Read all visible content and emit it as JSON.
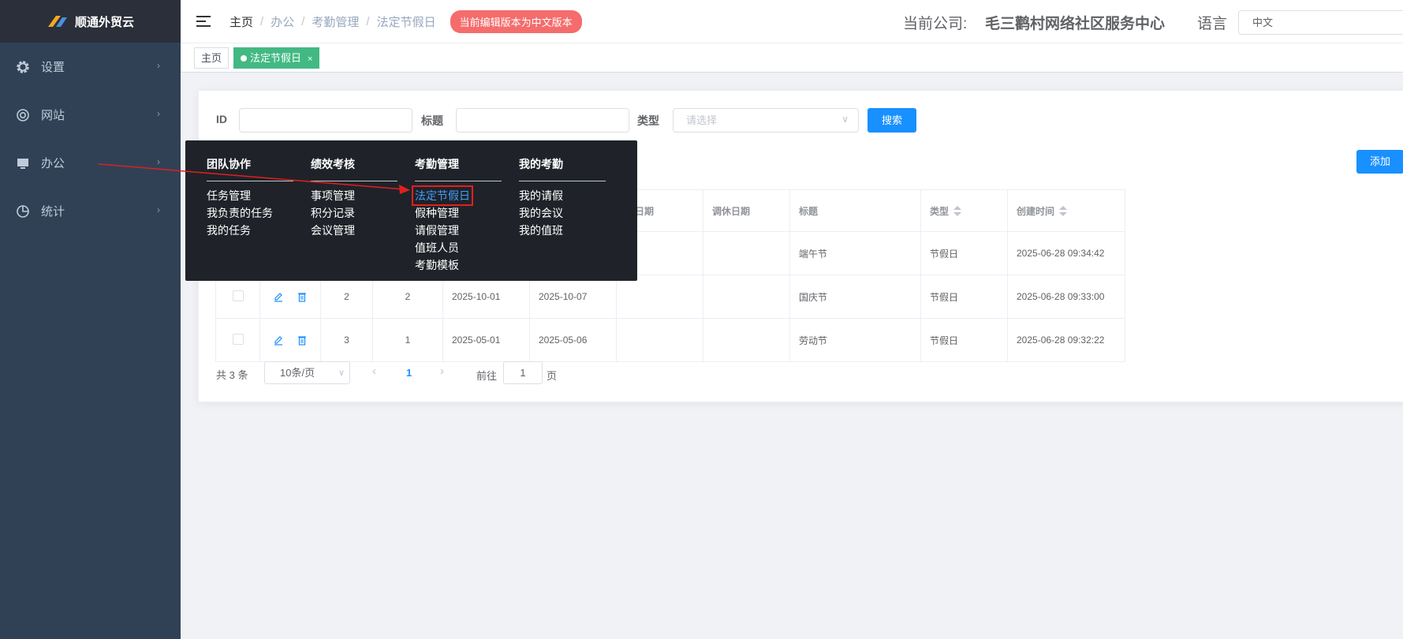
{
  "app": {
    "name": "顺通外贸云"
  },
  "sidebar": {
    "items": [
      {
        "label": "设置",
        "icon": "gear-icon"
      },
      {
        "label": "网站",
        "icon": "lifebuoy-icon"
      },
      {
        "label": "办公",
        "icon": "monitor-icon"
      },
      {
        "label": "统计",
        "icon": "pie-chart-icon"
      }
    ]
  },
  "header": {
    "breadcrumb": [
      "主页",
      "办公",
      "考勤管理",
      "法定节假日"
    ],
    "lang_badge": "当前编辑版本为中文版本",
    "company_label": "当前公司:",
    "company_name": "毛三鹳村网络社区服务中心",
    "lang_label": "语言",
    "lang_value": "中文"
  },
  "tags": {
    "home": "主页",
    "active": "法定节假日",
    "close": "×"
  },
  "filters": {
    "id_label": "ID",
    "title_label": "标题",
    "type_label": "类型",
    "type_placeholder": "请选择",
    "search_button": "搜索",
    "add_button": "添加"
  },
  "table": {
    "headers": [
      "",
      "",
      "",
      "",
      "",
      "",
      "班日期",
      "调休日期",
      "标题",
      "类型",
      "创建时间"
    ],
    "rows": [
      {
        "id": "",
        "num": "",
        "start": "",
        "end": "",
        "work": "",
        "rest": "",
        "title": "端午节",
        "type": "节假日",
        "created": "2025-06-28 09:34:42"
      },
      {
        "id": "2",
        "num": "2",
        "start": "2025-10-01",
        "end": "2025-10-07",
        "work": "",
        "rest": "",
        "title": "国庆节",
        "type": "节假日",
        "created": "2025-06-28 09:33:00"
      },
      {
        "id": "3",
        "num": "1",
        "start": "2025-05-01",
        "end": "2025-05-06",
        "work": "",
        "rest": "",
        "title": "劳动节",
        "type": "节假日",
        "created": "2025-06-28 09:32:22"
      }
    ]
  },
  "pagination": {
    "total": "共 3 条",
    "page_size": "10条/页",
    "current": "1",
    "goto_label": "前往",
    "goto_value": "1",
    "page_suffix": "页"
  },
  "mega_menu": {
    "columns": [
      {
        "title": "团队协作",
        "items": [
          "任务管理",
          "我负责的任务",
          "我的任务"
        ]
      },
      {
        "title": "绩效考核",
        "items": [
          "事项管理",
          "积分记录",
          "会议管理"
        ]
      },
      {
        "title": "考勤管理",
        "items": [
          "法定节假日",
          "假种管理",
          "请假管理",
          "值班人员",
          "考勤模板"
        ]
      },
      {
        "title": "我的考勤",
        "items": [
          "我的请假",
          "我的会议",
          "我的值班"
        ]
      }
    ]
  },
  "colors": {
    "sidebar": "#304156",
    "primary": "#1890ff",
    "active_tag": "#42b983",
    "badge": "#f56c6c",
    "highlight_box": "#e02020"
  }
}
